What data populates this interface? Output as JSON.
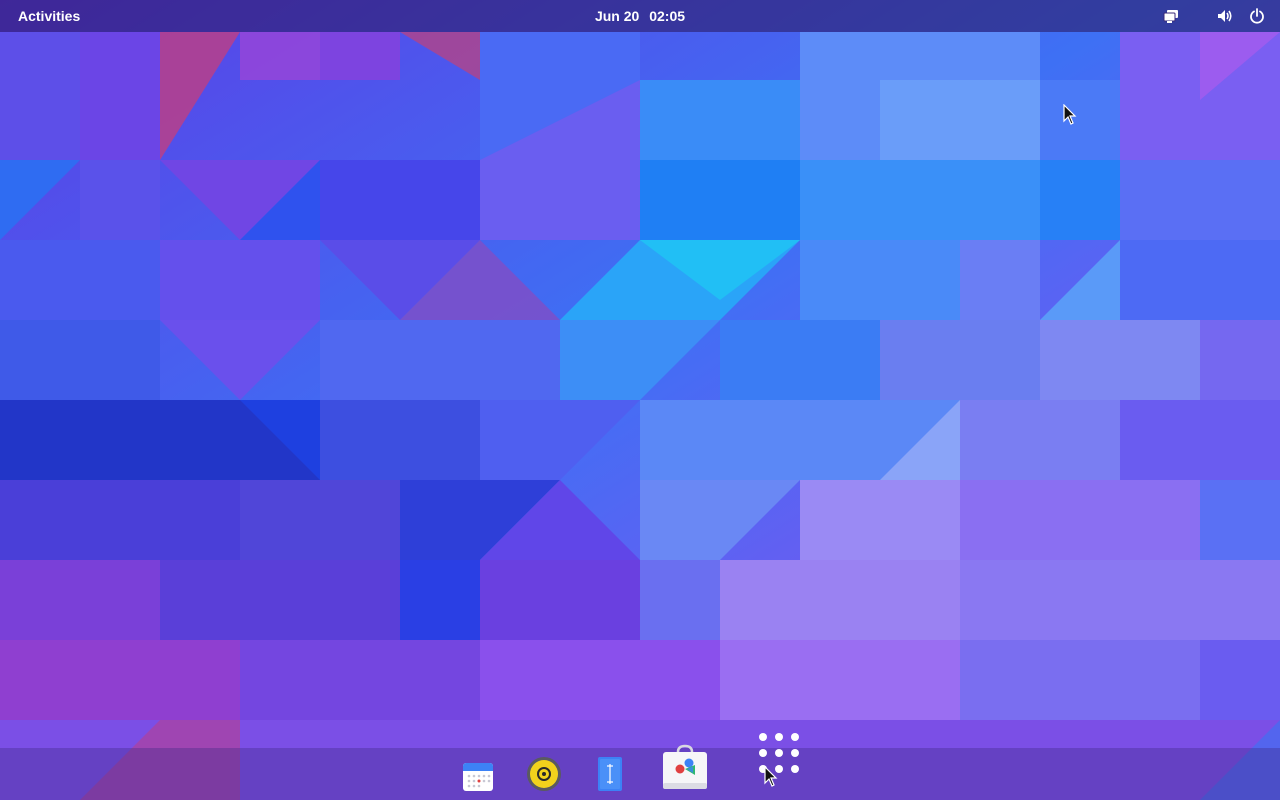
{
  "topbar": {
    "activities_label": "Activities",
    "date": "Jun 20",
    "time": "02:05",
    "tray_icons": [
      "screen-share-icon",
      "volume-icon",
      "power-icon"
    ]
  },
  "dock": {
    "apps": [
      {
        "name": "calendar-app-icon"
      },
      {
        "name": "rhythmbox-app-icon"
      },
      {
        "name": "text-editor-app-icon"
      },
      {
        "name": "software-store-app-icon"
      },
      {
        "name": "show-applications-icon"
      }
    ]
  },
  "colors": {
    "topbar_text": "#ffffff",
    "accent_blue": "#2f7ff2",
    "wallpaper_purple": "#6a45e8"
  }
}
